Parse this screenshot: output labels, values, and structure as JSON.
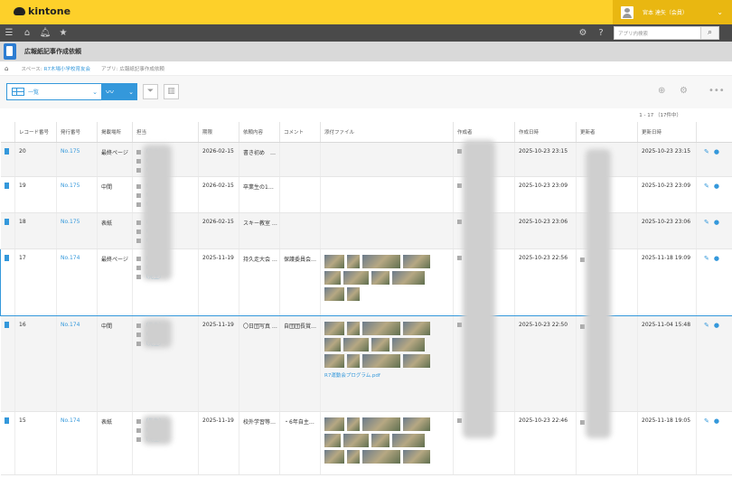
{
  "brand": {
    "name": "kintone"
  },
  "user": {
    "name": "宮本 達矢（会員）"
  },
  "search": {
    "placeholder": "アプリ内検索"
  },
  "app": {
    "title": "広報紙記事作成依頼"
  },
  "breadcrumb": {
    "space_label": "スペース:",
    "space": "R7木場小学校育友会",
    "app_label": "アプリ:",
    "app": "広報紙記事作成依頼"
  },
  "view": {
    "name": "一覧"
  },
  "pagecount": "1 - 17 （17件中）",
  "columns": [
    "",
    "レコード番号",
    "発行番号",
    "掲載場所",
    "担当",
    "期限",
    "依頼内容",
    "コメント",
    "添付ファイル",
    "作成者",
    "作成日時",
    "更新者",
    "更新日時",
    ""
  ],
  "rows": [
    {
      "id": "20",
      "issue": "No.175",
      "place": "最終ページ",
      "tanto": [
        "（先生）",
        "（先生）",
        "（先生）"
      ],
      "due": "2026-02-15",
      "req": "書き初め　…",
      "comment": "",
      "files": 0,
      "fname": "",
      "created": "2025-10-23 23:15",
      "updater": "",
      "updated": "2025-10-23 23:15"
    },
    {
      "id": "19",
      "issue": "No.175",
      "place": "中間",
      "tanto": [
        "（先生）",
        "（先生）",
        "（先生）"
      ],
      "due": "2026-02-15",
      "req": "卒業生の1…",
      "comment": "",
      "files": 0,
      "fname": "",
      "created": "2025-10-23 23:09",
      "updater": "",
      "updated": "2025-10-23 23:09"
    },
    {
      "id": "18",
      "issue": "No.175",
      "place": "表紙",
      "tanto": [
        "（先生）",
        "（先生）",
        "（先生）"
      ],
      "due": "2026-02-15",
      "req": "スキー教室 …",
      "comment": "",
      "files": 0,
      "fname": "",
      "created": "2025-10-23 23:06",
      "updater": "",
      "updated": "2025-10-23 23:06"
    },
    {
      "id": "17",
      "issue": "No.174",
      "place": "最終ページ",
      "tanto": [
        "（先生）",
        "（先生）",
        "（先生）"
      ],
      "due": "2025-11-19",
      "req": "持久走大会 …",
      "comment": "保護委員会…",
      "files": 10,
      "fname": "",
      "created": "2025-10-23 22:56",
      "updater": "（先生）",
      "updated": "2025-11-18 19:09"
    },
    {
      "id": "16",
      "issue": "No.174",
      "place": "中間",
      "tanto": [
        "（先生）",
        "（先生）",
        "（先生）"
      ],
      "due": "2025-11-19",
      "req": "〇日団写真 …",
      "comment": "自団団長賞…",
      "files": 12,
      "fname": "R7運動会プログラム.pdf",
      "created": "2025-10-23 22:50",
      "updater": "（先生）",
      "updated": "2025-11-04 15:48"
    },
    {
      "id": "15",
      "issue": "No.174",
      "place": "表紙",
      "tanto": [
        "（先生）",
        "（先生）",
        "（先生）"
      ],
      "due": "2025-11-19",
      "req": "校外学習等…",
      "comment": "・6年自主…",
      "files": 12,
      "fname": "",
      "created": "2025-10-23 22:46",
      "updater": "（先生）",
      "updated": "2025-11-18 19:05"
    }
  ]
}
